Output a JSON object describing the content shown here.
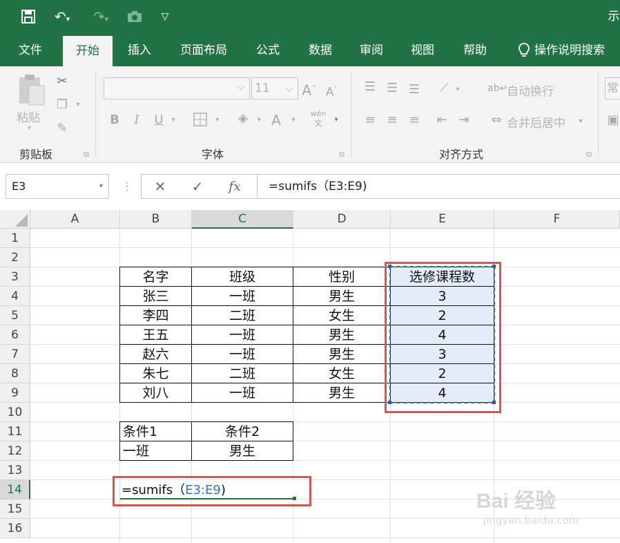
{
  "quick_access": {
    "save_icon": "save-icon",
    "undo_icon": "undo-icon",
    "redo_icon": "redo-icon",
    "camera_icon": "camera-icon",
    "customize_icon": "customize-dropdown-icon",
    "title_fragment": "示"
  },
  "ribbon_tabs": [
    {
      "label": "文件",
      "active": false
    },
    {
      "label": "开始",
      "active": true
    },
    {
      "label": "插入",
      "active": false
    },
    {
      "label": "页面布局",
      "active": false
    },
    {
      "label": "公式",
      "active": false
    },
    {
      "label": "数据",
      "active": false
    },
    {
      "label": "审阅",
      "active": false
    },
    {
      "label": "视图",
      "active": false
    },
    {
      "label": "帮助",
      "active": false
    }
  ],
  "tell_me": {
    "label": "操作说明搜索",
    "icon": "lightbulb-icon"
  },
  "ribbon": {
    "clipboard": {
      "paste_label": "粘贴",
      "group_label": "剪贴板"
    },
    "font": {
      "font_name": "",
      "font_size": "11",
      "group_label": "字体",
      "bold": "B",
      "italic": "I",
      "underline": "U",
      "grow": "A",
      "shrink": "A",
      "font_color": "A",
      "phonetic": "wén 文"
    },
    "alignment": {
      "wrap_text": "自动换行",
      "merge_center": "合并后居中",
      "group_label": "对齐方式"
    },
    "number": {
      "format_fragment": "常"
    }
  },
  "formula_bar": {
    "name_box": "E3",
    "cancel_icon": "✕",
    "enter_icon": "✓",
    "fx_label": "fx",
    "formula": "=sumifs（E3:E9)"
  },
  "sheet": {
    "columns": [
      "A",
      "B",
      "C",
      "D",
      "E",
      "F"
    ],
    "rows": [
      "1",
      "2",
      "3",
      "4",
      "5",
      "6",
      "7",
      "8",
      "9",
      "10",
      "11",
      "12",
      "13",
      "14",
      "15",
      "16"
    ],
    "table": {
      "headers": [
        "名字",
        "班级",
        "性别",
        "选修课程数"
      ],
      "rows": [
        [
          "张三",
          "一班",
          "男生",
          "3"
        ],
        [
          "李四",
          "二班",
          "女生",
          "2"
        ],
        [
          "王五",
          "一班",
          "男生",
          "4"
        ],
        [
          "赵六",
          "一班",
          "男生",
          "3"
        ],
        [
          "朱七",
          "二班",
          "女生",
          "2"
        ],
        [
          "刘八",
          "一班",
          "男生",
          "4"
        ]
      ]
    },
    "criteria": {
      "headers": [
        "条件1",
        "条件2"
      ],
      "values": [
        "一班",
        "男生"
      ]
    },
    "edit_cell": {
      "prefix": "=sumifs（",
      "ref": "E3:E9",
      "suffix": ")"
    }
  },
  "watermark": {
    "brand": "Bai 经验",
    "url": "jingyan.baidu.com"
  },
  "colors": {
    "excel_green": "#217346",
    "annotation_red": "#d9534f",
    "selection_fill": "#e3ecf7",
    "ref_blue": "#2e75b6"
  }
}
